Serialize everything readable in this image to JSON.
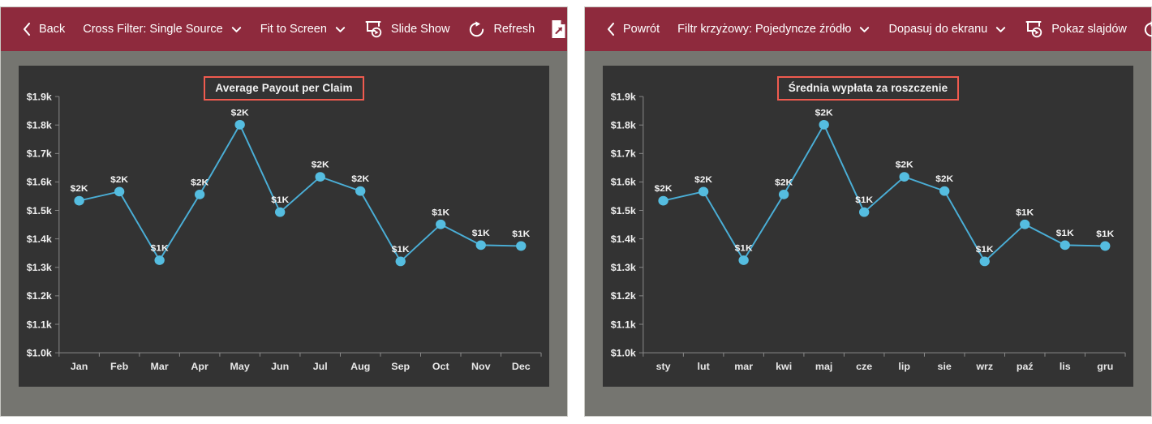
{
  "panels": [
    {
      "id": "left",
      "toolbar": {
        "back_label": "Back",
        "back_icon": "chevron-left-icon",
        "cross_filter_label": "Cross Filter: Single Source",
        "cross_filter_caret": "chevron-down-icon",
        "fit_label": "Fit to Screen",
        "fit_caret": "chevron-down-icon",
        "slideshow_label": "Slide Show",
        "slideshow_icon": "slideshow-icon",
        "refresh_label": "Refresh",
        "refresh_icon": "refresh-icon",
        "export_icon": "export-document-icon",
        "accent_color": "#8e2a3d"
      },
      "chart_data": {
        "type": "line",
        "title": "Average Payout per Claim",
        "xlabel": "",
        "ylabel": "",
        "grid": false,
        "legend": "none",
        "ylim": [
          1000,
          1900
        ],
        "ytick_labels": [
          "$1.9k",
          "$1.8k",
          "$1.7k",
          "$1.6k",
          "$1.5k",
          "$1.4k",
          "$1.3k",
          "$1.2k",
          "$1.1k",
          "$1.0k"
        ],
        "ytick_values": [
          1900,
          1800,
          1700,
          1600,
          1500,
          1400,
          1300,
          1200,
          1100,
          1000
        ],
        "categories": [
          "Jan",
          "Feb",
          "Mar",
          "Apr",
          "May",
          "Jun",
          "Jul",
          "Aug",
          "Sep",
          "Oct",
          "Nov",
          "Dec"
        ],
        "values": [
          1534,
          1566,
          1325,
          1556,
          1801,
          1494,
          1618,
          1568,
          1321,
          1451,
          1378,
          1375
        ],
        "point_labels": [
          "$2K",
          "$2K",
          "$1K",
          "$2K",
          "$2K",
          "$1K",
          "$2K",
          "$2K",
          "$1K",
          "$1K",
          "$1K",
          "$1K"
        ],
        "series_color": "#55bde0",
        "plot_background": "#333333"
      }
    },
    {
      "id": "right",
      "toolbar": {
        "back_label": "Powrót",
        "back_icon": "chevron-left-icon",
        "cross_filter_label": "Filtr krzyżowy: Pojedyncze źródło",
        "cross_filter_caret": "chevron-down-icon",
        "fit_label": "Dopasuj do ekranu",
        "fit_caret": "chevron-down-icon",
        "slideshow_label": "Pokaz slajdów",
        "slideshow_icon": "slideshow-icon",
        "refresh_label": "",
        "refresh_icon": "refresh-icon",
        "export_icon": "",
        "accent_color": "#8e2a3d"
      },
      "chart_data": {
        "type": "line",
        "title": "Średnia wypłata za roszczenie",
        "xlabel": "",
        "ylabel": "",
        "grid": false,
        "legend": "none",
        "ylim": [
          1000,
          1900
        ],
        "ytick_labels": [
          "$1.9k",
          "$1.8k",
          "$1.7k",
          "$1.6k",
          "$1.5k",
          "$1.4k",
          "$1.3k",
          "$1.2k",
          "$1.1k",
          "$1.0k"
        ],
        "ytick_values": [
          1900,
          1800,
          1700,
          1600,
          1500,
          1400,
          1300,
          1200,
          1100,
          1000
        ],
        "categories": [
          "sty",
          "lut",
          "mar",
          "kwi",
          "maj",
          "cze",
          "lip",
          "sie",
          "wrz",
          "paź",
          "lis",
          "gru"
        ],
        "values": [
          1534,
          1566,
          1325,
          1556,
          1801,
          1494,
          1618,
          1568,
          1321,
          1451,
          1378,
          1375
        ],
        "point_labels": [
          "$2K",
          "$2K",
          "$1K",
          "$2K",
          "$2K",
          "$1K",
          "$2K",
          "$2K",
          "$1K",
          "$1K",
          "$1K",
          "$1K"
        ],
        "series_color": "#55bde0",
        "plot_background": "#333333"
      }
    }
  ]
}
